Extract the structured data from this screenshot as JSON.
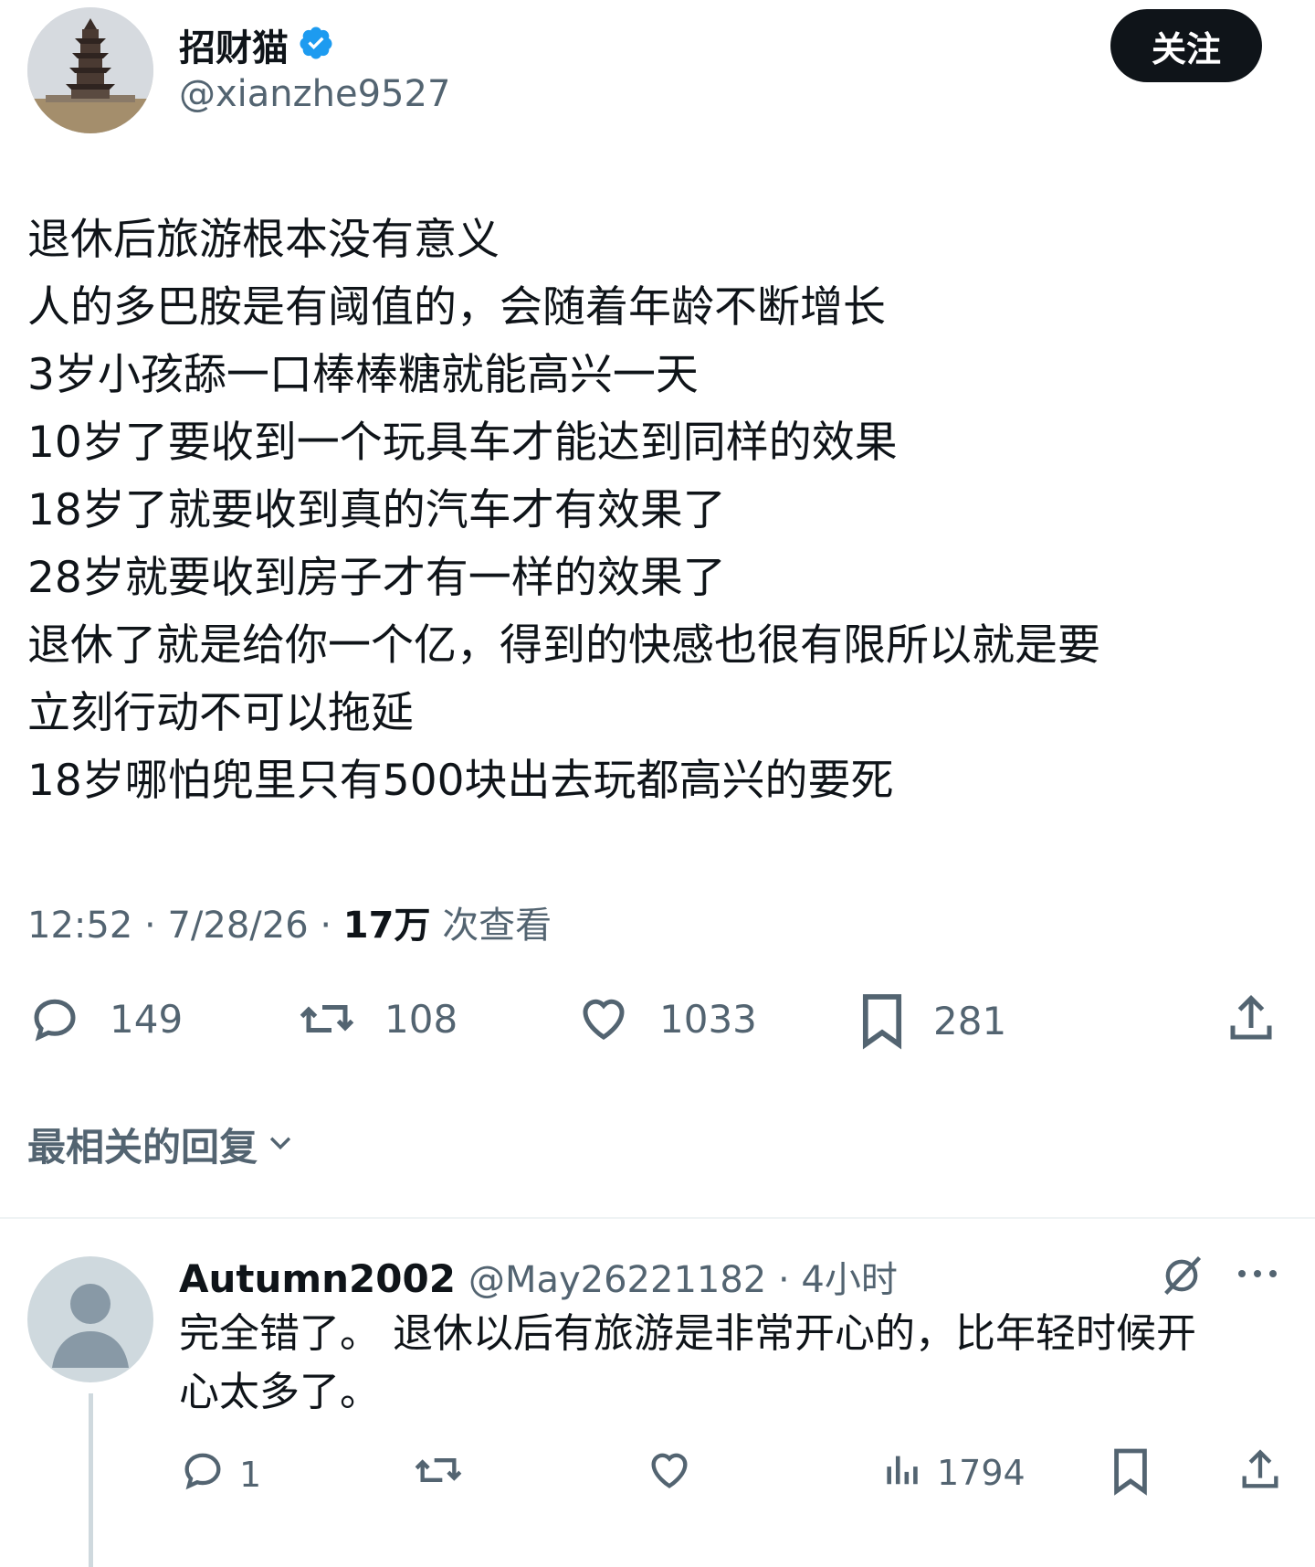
{
  "author": {
    "display_name": "招财猫",
    "handle": "@xianzhe9527",
    "verified": true
  },
  "follow_button": {
    "label": "关注"
  },
  "tweet": {
    "lines": [
      "退休后旅游根本没有意义",
      "人的多巴胺是有阈值的，会随着年龄不断增长",
      "3岁小孩舔一口棒棒糖就能高兴一天",
      "10岁了要收到一个玩具车才能达到同样的效果",
      "18岁了就要收到真的汽车才有效果了",
      "28岁就要收到房子才有一样的效果了",
      "退休了就是给你一个亿，得到的快感也很有限所以就是要",
      "立刻行动不可以拖延",
      "18岁哪怕兜里只有500块出去玩都高兴的要死"
    ]
  },
  "meta": {
    "time": "12:52",
    "date": "7/28/26",
    "views_count": "17万",
    "views_label": "次查看"
  },
  "stats": {
    "replies": "149",
    "retweets": "108",
    "likes": "1033",
    "bookmarks": "281"
  },
  "replies_section": {
    "title": "最相关的回复"
  },
  "reply": {
    "name": "Autumn2002",
    "handle_time": "@May2622118​2 · 4小时",
    "lines": [
      "完全错了。 退休以后有旅游是非常开心的，比年轻时候开",
      "心太多了。"
    ],
    "replies": "1",
    "views": "1794"
  },
  "colors": {
    "text": "#0f1419",
    "secondary": "#536471",
    "verified": "#1d9bf0",
    "button_bg": "#0f1419"
  },
  "icons": [
    "reply-icon",
    "retweet-icon",
    "like-icon",
    "bookmark-icon",
    "share-icon",
    "verified-icon",
    "chevron-down-icon",
    "views-icon",
    "grok-icon",
    "more-icon"
  ]
}
